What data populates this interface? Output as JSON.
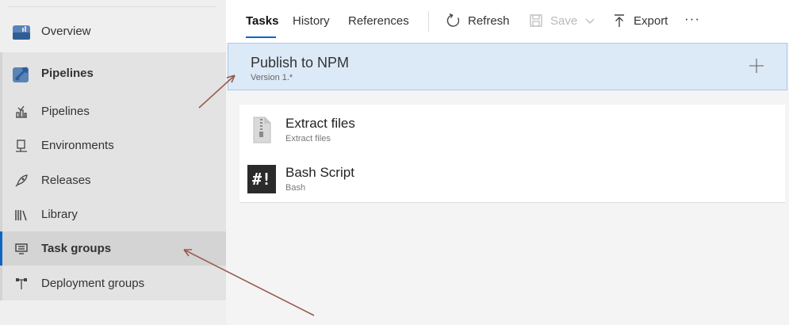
{
  "sidebar": {
    "overview": {
      "label": "Overview",
      "icon": "overview-icon"
    },
    "pipelines_header": {
      "label": "Pipelines",
      "icon": "pipelines-rocket-icon"
    },
    "items": [
      {
        "label": "Pipelines",
        "icon": "pipelines-icon"
      },
      {
        "label": "Environments",
        "icon": "environments-icon"
      },
      {
        "label": "Releases",
        "icon": "releases-icon"
      },
      {
        "label": "Library",
        "icon": "library-icon"
      },
      {
        "label": "Task groups",
        "icon": "task-groups-icon",
        "selected": true
      },
      {
        "label": "Deployment groups",
        "icon": "deployment-groups-icon"
      }
    ]
  },
  "toolbar": {
    "tabs": [
      {
        "label": "Tasks",
        "active": true
      },
      {
        "label": "History"
      },
      {
        "label": "References"
      }
    ],
    "refresh_label": "Refresh",
    "save_label": "Save",
    "export_label": "Export",
    "more_label": "···"
  },
  "task_group": {
    "title": "Publish to NPM",
    "version": "Version 1.*"
  },
  "tasks": [
    {
      "name": "Extract files",
      "subtitle": "Extract files",
      "icon": "zip-file-icon"
    },
    {
      "name": "Bash Script",
      "subtitle": "Bash",
      "icon": "bash-icon",
      "icon_text": "#!"
    }
  ],
  "colors": {
    "accent": "#0e66c2",
    "selected_bg": "#dce9f7",
    "annotation_arrow": "#9a5a4e"
  }
}
